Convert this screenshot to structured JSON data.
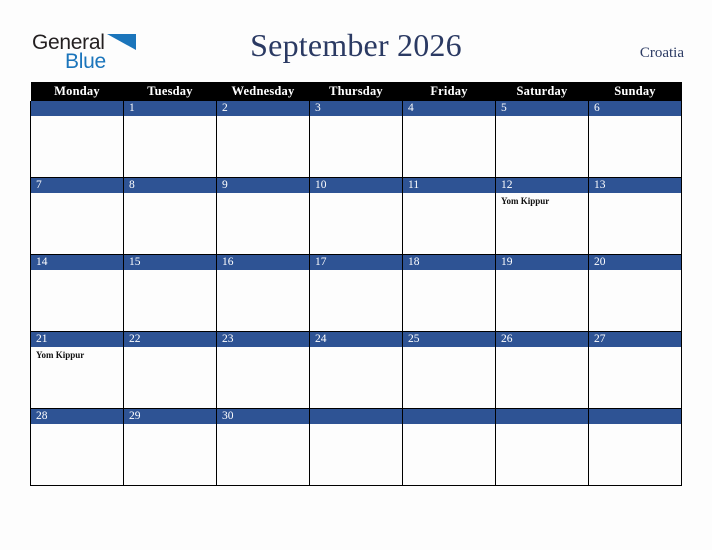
{
  "brand": {
    "name_part1": "General",
    "name_part2": "Blue",
    "triangle_icon": "blue-triangle-icon",
    "accent_color": "#1b75bb",
    "text_color": "#231f20"
  },
  "header": {
    "title": "September 2026",
    "month": "September",
    "year": "2026",
    "country": "Croatia",
    "title_color": "#2b3a63"
  },
  "colors": {
    "weekday_header_bg": "#000000",
    "weekday_header_text": "#ffffff",
    "day_band_bg": "#2e5394",
    "day_band_text": "#ffffff",
    "cell_bg": "#fdfdfd",
    "grid_border": "#000000",
    "page_bg": "#fdfdfd",
    "event_text": "#111111"
  },
  "weekdays": [
    "Monday",
    "Tuesday",
    "Wednesday",
    "Thursday",
    "Friday",
    "Saturday",
    "Sunday"
  ],
  "weeks": [
    [
      {
        "day": "",
        "events": []
      },
      {
        "day": "1",
        "events": []
      },
      {
        "day": "2",
        "events": []
      },
      {
        "day": "3",
        "events": []
      },
      {
        "day": "4",
        "events": []
      },
      {
        "day": "5",
        "events": []
      },
      {
        "day": "6",
        "events": []
      }
    ],
    [
      {
        "day": "7",
        "events": []
      },
      {
        "day": "8",
        "events": []
      },
      {
        "day": "9",
        "events": []
      },
      {
        "day": "10",
        "events": []
      },
      {
        "day": "11",
        "events": []
      },
      {
        "day": "12",
        "events": [
          "Yom Kippur"
        ]
      },
      {
        "day": "13",
        "events": []
      }
    ],
    [
      {
        "day": "14",
        "events": []
      },
      {
        "day": "15",
        "events": []
      },
      {
        "day": "16",
        "events": []
      },
      {
        "day": "17",
        "events": []
      },
      {
        "day": "18",
        "events": []
      },
      {
        "day": "19",
        "events": []
      },
      {
        "day": "20",
        "events": []
      }
    ],
    [
      {
        "day": "21",
        "events": [
          "Yom Kippur"
        ]
      },
      {
        "day": "22",
        "events": []
      },
      {
        "day": "23",
        "events": []
      },
      {
        "day": "24",
        "events": []
      },
      {
        "day": "25",
        "events": []
      },
      {
        "day": "26",
        "events": []
      },
      {
        "day": "27",
        "events": []
      }
    ],
    [
      {
        "day": "28",
        "events": []
      },
      {
        "day": "29",
        "events": []
      },
      {
        "day": "30",
        "events": []
      },
      {
        "day": "",
        "events": []
      },
      {
        "day": "",
        "events": []
      },
      {
        "day": "",
        "events": []
      },
      {
        "day": "",
        "events": []
      }
    ]
  ]
}
